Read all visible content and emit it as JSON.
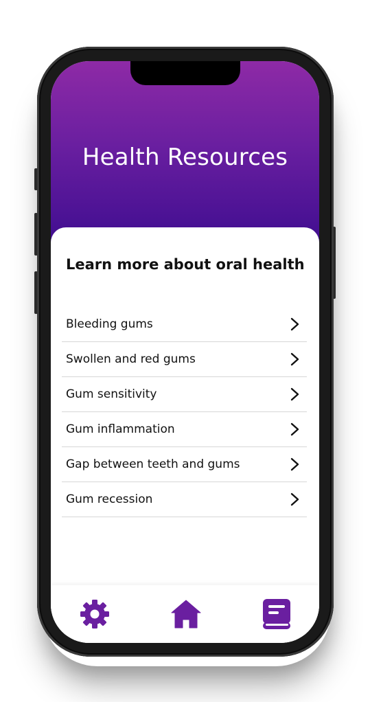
{
  "header": {
    "title": "Health Resources"
  },
  "content": {
    "section_title": "Learn more about oral health",
    "items": [
      {
        "label": "Bleeding gums"
      },
      {
        "label": "Swollen and red gums"
      },
      {
        "label": "Gum sensitivity"
      },
      {
        "label": "Gum inflammation"
      },
      {
        "label": "Gap between teeth and gums"
      },
      {
        "label": "Gum recession"
      }
    ]
  },
  "tabbar": {
    "tabs": [
      {
        "icon": "gear-icon"
      },
      {
        "icon": "home-icon"
      },
      {
        "icon": "book-icon"
      }
    ]
  },
  "colors": {
    "accent": "#6a1fa0",
    "header_top": "#8e2aa6",
    "header_bottom": "#3f0d90",
    "divider": "#d6d6d6"
  }
}
